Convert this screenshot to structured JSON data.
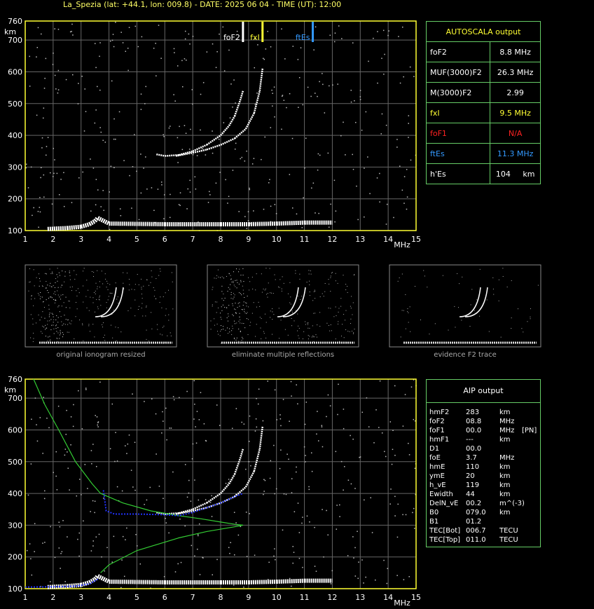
{
  "header": {
    "title": "La_Spezia (lat: +44.1, lon: 009.8) - DATE: 2025 06 04 - TIME (UT): 12:00"
  },
  "chart_data": [
    {
      "type": "scatter",
      "title": "",
      "xlabel": "MHz",
      "ylabel": "km",
      "xlim": [
        1,
        15
      ],
      "ylim": [
        100,
        760
      ],
      "xticks": [
        1,
        2,
        3,
        4,
        5,
        6,
        7,
        8,
        9,
        10,
        11,
        12,
        13,
        14,
        15
      ],
      "yticks": [
        100,
        200,
        300,
        400,
        500,
        600,
        700,
        760
      ],
      "grid": true,
      "markers": [
        {
          "name": "foF2",
          "x": 8.8,
          "color": "#ffffff"
        },
        {
          "name": "fxI",
          "x": 9.5,
          "color": "#ffff33"
        },
        {
          "name": "ftEs",
          "x": 11.3,
          "color": "#3399ff"
        }
      ],
      "series": [
        {
          "name": "o-trace",
          "x": [
            5.7,
            6.0,
            6.5,
            7.0,
            7.5,
            8.0,
            8.3,
            8.5,
            8.7,
            8.8
          ],
          "y": [
            340,
            335,
            338,
            350,
            370,
            400,
            430,
            460,
            510,
            540
          ]
        },
        {
          "name": "x-trace",
          "x": [
            6.4,
            7.0,
            7.5,
            8.0,
            8.5,
            8.9,
            9.2,
            9.4,
            9.5
          ],
          "y": [
            335,
            345,
            355,
            370,
            390,
            420,
            470,
            540,
            610
          ]
        },
        {
          "name": "E-layer",
          "x": [
            1.8,
            2.5,
            3.0,
            3.3,
            3.5,
            3.6,
            4.0,
            6.0,
            8.0,
            9.0,
            10.0,
            11.0,
            12.0
          ],
          "y": [
            105,
            108,
            112,
            120,
            130,
            140,
            122,
            120,
            120,
            120,
            122,
            125,
            125
          ]
        }
      ]
    },
    {
      "type": "line",
      "title": "",
      "xlabel": "MHz",
      "ylabel": "km",
      "xlim": [
        1,
        15
      ],
      "ylim": [
        100,
        760
      ],
      "grid": true,
      "series": [
        {
          "name": "profile",
          "x": [
            1.3,
            1.7,
            2.2,
            2.8,
            3.4,
            3.7,
            4.5,
            5.5,
            6.5,
            7.3,
            8.0,
            8.5,
            8.8,
            8.5,
            7.5,
            6.5,
            5.0,
            4.0,
            3.7
          ],
          "y": [
            760,
            680,
            600,
            500,
            430,
            400,
            370,
            345,
            330,
            320,
            310,
            303,
            300,
            295,
            280,
            260,
            220,
            175,
            150
          ]
        },
        {
          "name": "fitted-trace",
          "x": [
            3.8,
            3.9,
            4.2,
            5.0,
            6.0,
            6.5,
            7.0,
            7.5,
            8.0,
            8.5,
            8.8
          ],
          "y": [
            410,
            345,
            335,
            335,
            333,
            330,
            340,
            355,
            370,
            390,
            400
          ]
        },
        {
          "name": "E-profile",
          "x": [
            1.0,
            2.0,
            2.8,
            3.3,
            3.6
          ],
          "y": [
            105,
            106,
            108,
            115,
            130
          ]
        }
      ]
    }
  ],
  "autoscala": {
    "title": "AUTOSCALA output",
    "rows": [
      {
        "label": "foF2",
        "value": "8.8 MHz",
        "color": "#ffffff"
      },
      {
        "label": "MUF(3000)F2",
        "value": "26.3 MHz",
        "color": "#ffffff"
      },
      {
        "label": "M(3000)F2",
        "value": "2.99",
        "color": "#ffffff"
      },
      {
        "label": "fxI",
        "value": "9.5 MHz",
        "color": "#ffff33"
      },
      {
        "label": "foF1",
        "value": "N/A",
        "color": "#ff2222"
      },
      {
        "label": "ftEs",
        "value": "11.3 MHz",
        "color": "#3399ff"
      },
      {
        "label": "h'Es",
        "value": "104     km",
        "color": "#ffffff"
      }
    ]
  },
  "aip": {
    "title": "AIP output",
    "rows": [
      [
        "hmF2",
        "283",
        "km",
        ""
      ],
      [
        "foF2",
        "08.8",
        "MHz",
        ""
      ],
      [
        "foF1",
        "00.0",
        "MHz",
        "[PN]"
      ],
      [
        "hmF1",
        "---",
        "km",
        ""
      ],
      [
        "D1",
        "00.0",
        "",
        ""
      ],
      [
        "foE",
        "3.7",
        "MHz",
        ""
      ],
      [
        "hmE",
        "110",
        "km",
        ""
      ],
      [
        "ymE",
        "20",
        "km",
        ""
      ],
      [
        "h_vE",
        "119",
        "km",
        ""
      ],
      [
        "Ewidth",
        "44",
        "km",
        ""
      ],
      [
        "DelN_vE",
        "00.2",
        "m^(-3)",
        ""
      ],
      [
        "B0",
        "079.0",
        "km",
        ""
      ],
      [
        "B1",
        "01.2",
        "",
        ""
      ],
      [
        "TEC[Bot]",
        "006.7",
        "TECU",
        ""
      ],
      [
        "TEC[Top]",
        "011.0",
        "TECU",
        ""
      ]
    ]
  },
  "thumbnails": [
    {
      "caption": "original ionogram resized"
    },
    {
      "caption": "eliminate multiple reflections"
    },
    {
      "caption": "evidence F2 trace"
    }
  ],
  "colors": {
    "axis": "#ffff33",
    "grid": "#666666",
    "box": "#66cc66",
    "profile": "#33cc33",
    "fit": "#2233ff"
  }
}
